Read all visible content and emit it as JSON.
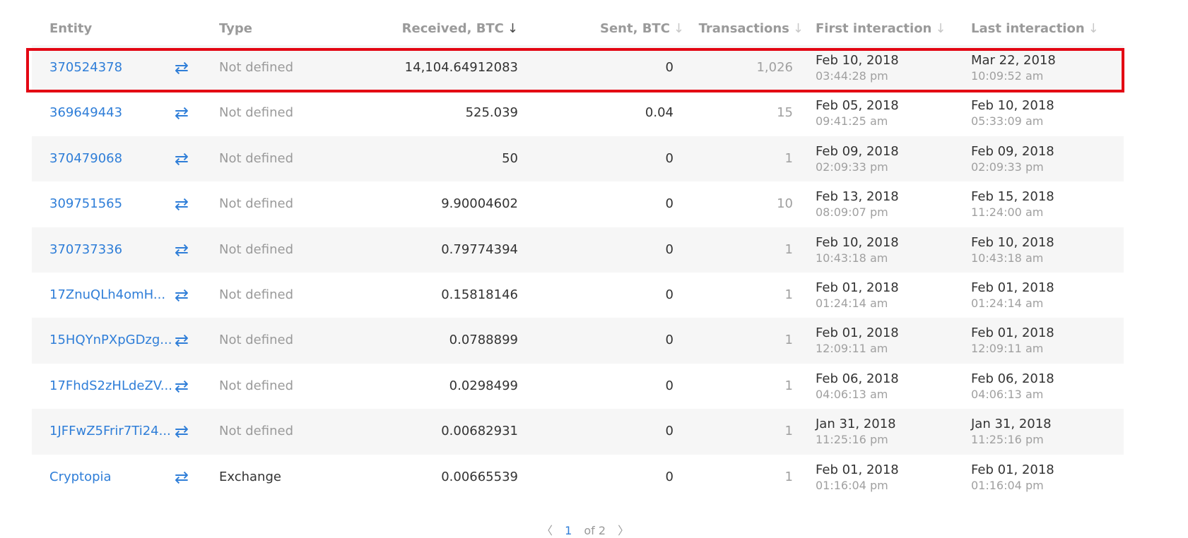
{
  "header": {
    "entity": "Entity",
    "type": "Type",
    "received": "Received, BTC",
    "sent": "Sent, BTC",
    "transactions": "Transactions",
    "first": "First interaction",
    "last": "Last interaction",
    "sort_arrow": "↓"
  },
  "swap_icon": "⇄",
  "rows": [
    {
      "entity": "370524378",
      "type": "Not defined",
      "received": "14,104.64912083",
      "sent": "0",
      "tx": "1,026",
      "first_date": "Feb 10, 2018",
      "first_time": "03:44:28 pm",
      "last_date": "Mar 22, 2018",
      "last_time": "10:09:52 am"
    },
    {
      "entity": "369649443",
      "type": "Not defined",
      "received": "525.039",
      "sent": "0.04",
      "tx": "15",
      "first_date": "Feb 05, 2018",
      "first_time": "09:41:25 am",
      "last_date": "Feb 10, 2018",
      "last_time": "05:33:09 am"
    },
    {
      "entity": "370479068",
      "type": "Not defined",
      "received": "50",
      "sent": "0",
      "tx": "1",
      "first_date": "Feb 09, 2018",
      "first_time": "02:09:33 pm",
      "last_date": "Feb 09, 2018",
      "last_time": "02:09:33 pm"
    },
    {
      "entity": "309751565",
      "type": "Not defined",
      "received": "9.90004602",
      "sent": "0",
      "tx": "10",
      "first_date": "Feb 13, 2018",
      "first_time": "08:09:07 pm",
      "last_date": "Feb 15, 2018",
      "last_time": "11:24:00 am"
    },
    {
      "entity": "370737336",
      "type": "Not defined",
      "received": "0.79774394",
      "sent": "0",
      "tx": "1",
      "first_date": "Feb 10, 2018",
      "first_time": "10:43:18 am",
      "last_date": "Feb 10, 2018",
      "last_time": "10:43:18 am"
    },
    {
      "entity": "17ZnuQLh4omH...",
      "type": "Not defined",
      "received": "0.15818146",
      "sent": "0",
      "tx": "1",
      "first_date": "Feb 01, 2018",
      "first_time": "01:24:14 am",
      "last_date": "Feb 01, 2018",
      "last_time": "01:24:14 am"
    },
    {
      "entity": "15HQYnPXpGDzg...",
      "type": "Not defined",
      "received": "0.0788899",
      "sent": "0",
      "tx": "1",
      "first_date": "Feb 01, 2018",
      "first_time": "12:09:11 am",
      "last_date": "Feb 01, 2018",
      "last_time": "12:09:11 am"
    },
    {
      "entity": "17FhdS2zHLdeZV...",
      "type": "Not defined",
      "received": "0.0298499",
      "sent": "0",
      "tx": "1",
      "first_date": "Feb 06, 2018",
      "first_time": "04:06:13 am",
      "last_date": "Feb 06, 2018",
      "last_time": "04:06:13 am"
    },
    {
      "entity": "1JFFwZ5Frir7Ti24...",
      "type": "Not defined",
      "received": "0.00682931",
      "sent": "0",
      "tx": "1",
      "first_date": "Jan 31, 2018",
      "first_time": "11:25:16 pm",
      "last_date": "Jan 31, 2018",
      "last_time": "11:25:16 pm"
    },
    {
      "entity": "Cryptopia",
      "type": "Exchange",
      "received": "0.00665539",
      "sent": "0",
      "tx": "1",
      "first_date": "Feb 01, 2018",
      "first_time": "01:16:04 pm",
      "last_date": "Feb 01, 2018",
      "last_time": "01:16:04 pm"
    }
  ],
  "pager": {
    "prev": "〈",
    "current": "1",
    "of_text": "of 2",
    "next": "〉"
  },
  "colors": {
    "link": "#2f7ed8",
    "highlight": "#e30613"
  }
}
